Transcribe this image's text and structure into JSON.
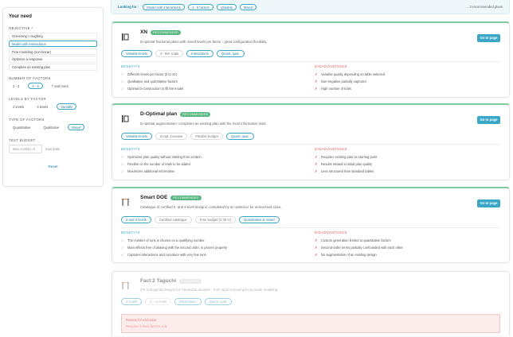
{
  "sidebar": {
    "title": "Your need",
    "objective_label": "OBJECTIVE *",
    "objectives": [
      {
        "label": "Screening / roughing",
        "selected": false
      },
      {
        "label": "Model with interactions",
        "selected": true
      },
      {
        "label": "Fine modeling (non-linear)",
        "selected": false
      },
      {
        "label": "Optimize a response",
        "selected": false
      },
      {
        "label": "Complete an existing plan",
        "selected": false
      }
    ],
    "factors_label": "NUMBER OF FACTORS",
    "factors": [
      {
        "label": "2 - 3",
        "selected": false
      },
      {
        "label": "4 - 6",
        "selected": true
      },
      {
        "label": "7 and more",
        "selected": false
      }
    ],
    "levels_label": "LEVELS BY FACTOR",
    "levels": [
      {
        "label": "2 levels",
        "selected": false
      },
      {
        "label": "3 levels",
        "selected": false
      },
      {
        "label": "Variable",
        "selected": true
      }
    ],
    "type_label": "TYPE OF FACTORS",
    "types": [
      {
        "label": "Quantitative",
        "selected": false
      },
      {
        "label": "Qualitative",
        "selected": false
      },
      {
        "label": "Mixed",
        "selected": true
      }
    ],
    "budget_label": "TEST BUDGET",
    "budget_placeholder": "Max number of",
    "budget_suffix": "max tests",
    "reset_label": "Reset"
  },
  "looking": {
    "label": "Looking for :",
    "chips": [
      "Model with interactions",
      "4 - 6 factors",
      "Variable",
      "Mixed"
    ],
    "count": "→ 3 recommended plans"
  },
  "cards": [
    {
      "title": "XN",
      "badge": "RECOMMENDED",
      "desc": "D-optimal fractional plans with mixed levels per factor - great configuration flexibility.",
      "button": "Go to page",
      "chips": [
        {
          "label": "Variable levels",
          "match": true
        },
        {
          "label": "4 - 99+ trials",
          "match": false
        },
        {
          "label": "Interactions",
          "match": true
        },
        {
          "label": "Quant. qual.",
          "match": true
        }
      ],
      "benefits_title": "BENEFITS",
      "benefits": [
        "Different levels per factor (2 to 10)",
        "Qualitative and quantitative factors",
        "Optimal D-construction to fill the model"
      ],
      "drawbacks_title": "DISADVANTAGES",
      "drawbacks": [
        "Variable quality depending on table selected",
        "Non-negative partially captured",
        "High number of trials"
      ]
    },
    {
      "title": "D-Optimal plan",
      "badge": "RECOMMENDED",
      "desc": "D-optimal augmentation: completes an existing plan with the most informative trials.",
      "button": "Go to page",
      "chips": [
        {
          "label": "Variable levels",
          "match": true
        },
        {
          "label": "D-opt. increase",
          "match": false
        },
        {
          "label": "Flexible budget",
          "match": false
        },
        {
          "label": "Quant. qual.",
          "match": true
        }
      ],
      "benefits_title": "BENEFITS",
      "benefits": [
        "Optimized plan quality without starting from scratch",
        "Flexible on the number of trials to be added",
        "Maximizes additional information"
      ],
      "drawbacks_title": "DISADVANTAGES",
      "drawbacks": [
        "Requires existing plan as starting point",
        "Results related to initial plan quality",
        "Less structured than standard tables"
      ]
    },
    {
      "title": "Smart DOE",
      "badge": "RECOMMENDED",
      "desc": "Catalogue of certified 2- and 3-level designs, completed by an optimizer for unreversed sizes.",
      "button": "Go to page",
      "chips": [
        {
          "label": "2 and 3 levels",
          "match": true
        },
        {
          "label": "Certified catalogue",
          "match": false
        },
        {
          "label": "Free budget (2 3k+1)",
          "match": false
        },
        {
          "label": "Quantitative & mixed",
          "match": true
        }
      ],
      "benefits_title": "BENEFITS",
      "benefits": [
        "The number of runs is chosen on a qualifying number",
        "Main effects free of aliasing with the second order, in proven property",
        "Captures interactions and curvature with very few runs"
      ],
      "drawbacks_title": "DISADVANTAGES",
      "drawbacks": [
        "Custom generation limited to quantitative factors",
        "Second-order terms partially confounded with each other",
        "No augmentation of an existing design"
      ]
    },
    {
      "title": "Fact 2 Taguchi",
      "badge": "EXCLUDED",
      "desc": "2^k orthogonal designs for interaction analysis - from rapid screening to accurate modeling.",
      "chips": [
        {
          "label": "2 levels",
          "match": true
        },
        {
          "label": "4 - 14 trials",
          "match": false
        },
        {
          "label": "Interactions",
          "match": true
        },
        {
          "label": "Quant. qual.",
          "match": true
        }
      ],
      "reason_title": "Reason for exclusion:",
      "reason_detail": "Requires 2-level factors only"
    }
  ]
}
